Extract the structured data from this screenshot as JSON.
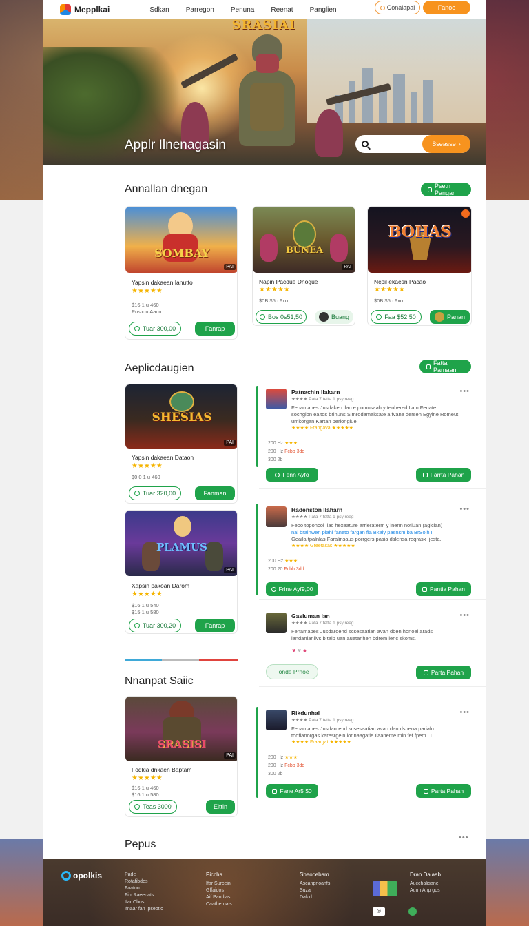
{
  "header": {
    "logo": "Mepplkai",
    "nav": [
      "Sdkan",
      "Parregon",
      "Penuna",
      "Reenat",
      "Panglien"
    ],
    "outline_button": "Conalapal",
    "primary_button": "Fanoe"
  },
  "hero": {
    "art_title": "SRASIAI",
    "heading": "Applr Ilnenagasin",
    "search_placeholder": "",
    "search_button": "Sseasse"
  },
  "section1": {
    "title": "Annallan dnegan",
    "button": "Psetn Pangar",
    "cards": [
      {
        "art": "SOMBAY",
        "corner": "PAI",
        "title": "Yapsin dakaean Ianutto",
        "stars": "★★★★★",
        "meta1": "$16 1 u 460",
        "meta2": "Pusic u Aacn",
        "price": "Tuar 300,00",
        "button": "Fanrap"
      },
      {
        "art": "BUNEA",
        "corner": "PAI",
        "title": "Napin Pacdue Dnogue",
        "stars": "★★★★★",
        "meta1": "$0B $5c Fxo",
        "meta2": "",
        "price": "Bos 0s51,50",
        "button": "Buang"
      },
      {
        "art": "BOHAS",
        "corner": "",
        "title": "Ncpil ekaesn Pacao",
        "stars": "★★★★★",
        "meta1": "$0B $5c Fxo",
        "meta2": "",
        "price": "Faa $52,50",
        "button": "Panan"
      }
    ]
  },
  "section2": {
    "title": "Aeplicdaugien",
    "button": "Fatta Pamaan",
    "cards": [
      {
        "art": "SHESIAS",
        "corner": "PAI",
        "title": "Yapsin dakaean Dataon",
        "stars": "★★★★★",
        "meta1": "$0.0 1 u 460",
        "meta2": "",
        "price": "Tuar 320,00",
        "button": "Fanman"
      },
      {
        "art": "PLAMUS",
        "corner": "PAI",
        "title": "Xapsin pakoan Darom",
        "stars": "★★★★★",
        "meta1": "$16 1 u 540",
        "meta2": "$15 1 u 580",
        "price": "Tuar 300,20",
        "button": "Fanrap"
      }
    ]
  },
  "reviews": [
    {
      "name": "Patnachin Ilakarn",
      "rating_line": "★★★★ Pata 7 tetta 1 psy reeg",
      "body1": "Fenamapes Jusdaken ilao e pomosaah y tenbered Ilam Fenate",
      "body2": "sochgion ealtos brinuns Simrodamaksate a fvane dersen Egyine Romeut",
      "body3": "umkorgan Kartan perlongiue.",
      "tagline": "★★★★ Frangava ★★★★★",
      "stat1": "200 Hz",
      "stat2": "200 Hz",
      "stat3": "300 2b",
      "btn_left": "Fenn Ayfo",
      "btn_right": "Farrta Pahan"
    },
    {
      "name": "Hadenston Ilaharn",
      "rating_line": "★★★★ Pata 7 tetta 1 psy reeg",
      "body1": "Feoo toponcol Ilac hexeature arrieraterm y lnenn notiuan (agician)",
      "body2": "nal brainwen plahi faneto fargan fia Bkaiy pasnsm ba BrSolh Ii",
      "body3": "Geaila tpalnlas Faralinsaus porrgers pasia dslensa reqrasx Ijesta.",
      "tagline": "★★★★ Greetasas ★★★★★",
      "stat1": "200 Hz",
      "stat2": "200.20",
      "stat3": "",
      "btn_left": "Frine Ayf9,00",
      "btn_right": "Pantia Pahan"
    },
    {
      "name": "Gasluman Ian",
      "rating_line": "★★★★ Pata 7 tetta 1 psy reeg",
      "body1": "Fenamapes Jusdaroend scsesaatian avan dben honoel arads",
      "body2": "landanlanlivs b talp uan auetanhen bdrem lenc skoms.",
      "body3": "",
      "tagline": "",
      "btn_left": "Fonde Prnoe",
      "btn_right": "Parta Pahan"
    },
    {
      "name": "Rikdunhal",
      "rating_line": "★★★★ Pata 7 tetta 1 psy reeg",
      "body1": "Fenamapes Jusdaroend scsesaatian avan dan dspena parialo",
      "body2": "tooflanorgas karesrgein lorinaagatle Ilaaneme min fef fpem LI",
      "body3": "",
      "tagline": "★★★★ Fraargat ★★★★★",
      "stat1": "200 Hz",
      "stat2": "200 Hz",
      "stat3": "300 2b",
      "btn_left": "Fane Ar5 $0",
      "btn_right": "Parta Pahan"
    }
  ],
  "section3": {
    "title": "Nnanpat Saiic",
    "card": {
      "art": "SRASISI",
      "corner": "PAI",
      "title": "Fodkia dnkaen Baptam",
      "stars": "★★★★★",
      "meta1": "$16 1 u 460",
      "meta2": "$16 1 u 580",
      "price": "Teas 3000",
      "button": "Eittin"
    }
  },
  "bottom_title": "Pepus",
  "footer": {
    "logo": "opolkis",
    "col1": [
      "Pade",
      "Rotafibdes",
      "Faatun",
      "Firr Raeenats",
      "Ifar Cbus",
      "Ifnaar fan Ipseotic"
    ],
    "col2_head": "Piccha",
    "col2": [
      "Ifar Surcein",
      "Gffaidos",
      "Aif Pandias",
      "Caatheruais"
    ],
    "col3_head": "Sbeocebam",
    "col3": [
      "Ascanpnoanfs",
      "",
      "Suza",
      "Dakid"
    ],
    "col4_head": "Dran Dalaab",
    "col4": [
      "Aucchalisane",
      "Aunn Anp gos"
    ]
  },
  "colors": {
    "accent_orange": "#f7931e",
    "accent_green": "#1fa34a"
  }
}
